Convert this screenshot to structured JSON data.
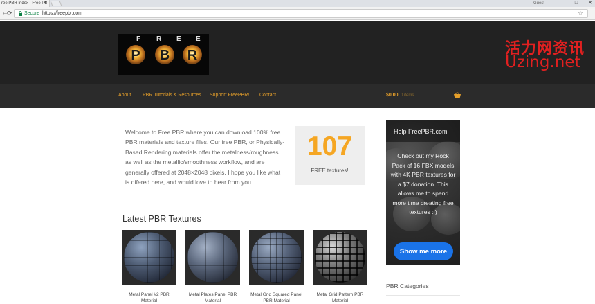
{
  "browser": {
    "tab_title": "ree PBR Index - Free PB",
    "tab_close": "✕",
    "profile_label": "Guest",
    "window_controls": [
      "–",
      "□",
      "✕"
    ],
    "nav": {
      "back": "←",
      "forward": "→",
      "reload": "⟳"
    },
    "secure_label": "Secure",
    "url": "https://freepbr.com",
    "bookmark_icon": "☆"
  },
  "site": {
    "logo": {
      "free_letters": [
        "F",
        "R",
        "E",
        "E"
      ],
      "pbr_letters": [
        "P",
        "B",
        "R"
      ]
    },
    "nav_links": [
      "About",
      "PBR Tutorials & Resources",
      "Support FreePBR!",
      "Contact"
    ],
    "cart": {
      "total": "$0.00",
      "items": "0 items"
    },
    "watermark": {
      "line1": "活力网资讯",
      "line2": "Uzing.net"
    }
  },
  "main": {
    "intro": "Welcome to Free PBR where you can download 100% free PBR materials and texture files.  Our free PBR, or Physically-Based Rendering materials offer the metalness/roughness as well as the metallic/smoothness workflow, and are generally offered at 2048×2048 pixels. I hope you like what is offered here, and would love to hear from you.",
    "counter": {
      "number": "107",
      "label": "FREE textures!"
    },
    "latest_title": "Latest PBR Textures",
    "products": [
      {
        "name": "Metal Panel #2 PBR Material"
      },
      {
        "name": "Metal Plates Panel PBR Material"
      },
      {
        "name": "Metal Grid Squared Panel PBR Material"
      },
      {
        "name": "Metal Grid Pattern PBR Material"
      }
    ]
  },
  "sidebar": {
    "promo": {
      "title": "Help FreePBR.com",
      "text": "Check out my Rock Pack of 16 FBX models with 4K PBR textures for a $7 donation. This allows me to spend more time creating free textures : )",
      "button": "Show me more"
    },
    "categories_title": "PBR Categories"
  },
  "colors": {
    "accent": "#e59f2a",
    "counter": "#f5a623",
    "button": "#1a73e8",
    "watermark": "#e02020"
  }
}
